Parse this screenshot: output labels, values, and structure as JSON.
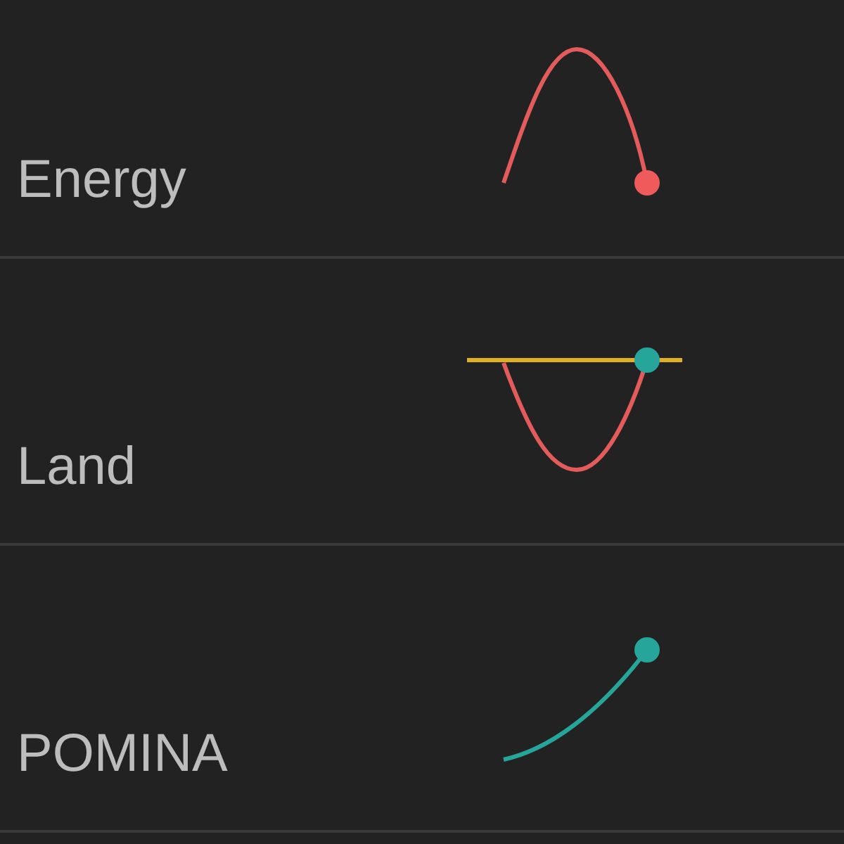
{
  "rows": [
    {
      "name": "Energy",
      "sparkline": {
        "kind": "arch"
      }
    },
    {
      "name": "Land",
      "sparkline": {
        "kind": "dip"
      }
    },
    {
      "name": "POMINA",
      "sparkline": {
        "kind": "rise"
      }
    }
  ]
}
